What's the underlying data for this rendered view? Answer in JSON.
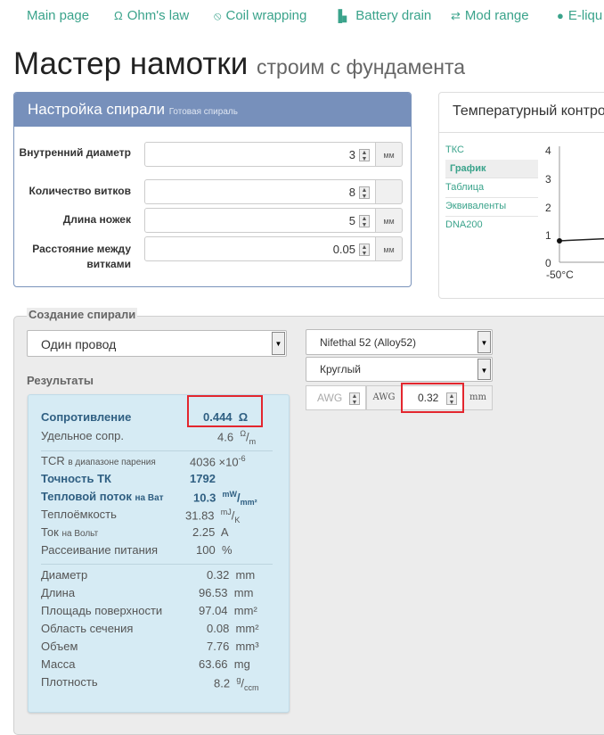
{
  "nav": [
    {
      "icon": "",
      "label": "Main page"
    },
    {
      "icon": "Ω",
      "label": "Ohm's law"
    },
    {
      "icon": "⦸",
      "label": "Coil wrapping"
    },
    {
      "icon": "▖",
      "label": "Battery drain"
    },
    {
      "icon": "⇄",
      "label": "Mod range"
    },
    {
      "icon": "💧",
      "label": "E-liqu"
    }
  ],
  "title": {
    "main": "Мастер намотки",
    "sub": "строим с фундамента"
  },
  "coil_settings": {
    "header": "Настройка спирали",
    "header_small": "Готовая спираль",
    "rows": [
      {
        "label": "Внутренний диаметр",
        "value": "3",
        "unit": "мм"
      },
      {
        "label": "Количество витков",
        "value": "8",
        "unit": ""
      },
      {
        "label": "Длина ножек",
        "value": "5",
        "unit": "мм"
      },
      {
        "label": "Расстояние между витками",
        "value": "0.05",
        "unit": "мм"
      }
    ]
  },
  "temp_panel": {
    "header": "Температурный контро",
    "menu": [
      "ТКС",
      "График",
      "Таблица",
      "Эквиваленты",
      "DNA200"
    ],
    "active": "График",
    "y_ticks": [
      "4",
      "3",
      "2",
      "1",
      "0"
    ],
    "x_tick": "-50°C"
  },
  "creation": {
    "legend": "Создание спирали",
    "wire_type": "Один провод",
    "material": "Nifethal 52 (Alloy52)",
    "profile": "Круглый",
    "awg_placeholder": "AWG",
    "awg_label": "AWG",
    "diameter_value": "0.32",
    "diameter_unit": "mm"
  },
  "results": {
    "title": "Результаты",
    "resistance": {
      "label": "Сопротивление",
      "value": "0.444",
      "unit": "Ω"
    },
    "specific": {
      "label": "Удельное сопр.",
      "value": "4.6",
      "unit_sup": "Ω",
      "unit_sub": "m"
    },
    "tcr": {
      "label": "TCR",
      "label_small": "в диапазоне парения",
      "value": "4036",
      "unit": "×10",
      "unit_sup": "-6"
    },
    "accuracy": {
      "label": "Точность ТК",
      "value": "1792"
    },
    "heat_flux": {
      "label": "Тепловой поток",
      "label_small": "на Ват",
      "value": "10.3",
      "unit_sup": "mW",
      "unit_sub": "mm²"
    },
    "heat_capacity": {
      "label": "Теплоёмкость",
      "value": "31.83",
      "unit_sup": "mJ",
      "unit_sub": "K"
    },
    "current": {
      "label": "Ток",
      "label_small": "на Вольт",
      "value": "2.25",
      "unit": "A"
    },
    "dissipation": {
      "label": "Рассеивание питания",
      "value": "100",
      "unit": "%"
    },
    "diameter": {
      "label": "Диаметр",
      "value": "0.32",
      "unit": "mm"
    },
    "length": {
      "label": "Длина",
      "value": "96.53",
      "unit": "mm"
    },
    "surface": {
      "label": "Площадь поверхности",
      "value": "97.04",
      "unit": "mm²"
    },
    "section": {
      "label": "Область сечения",
      "value": "0.08",
      "unit": "mm²"
    },
    "volume": {
      "label": "Объем",
      "value": "7.76",
      "unit": "mm³"
    },
    "mass": {
      "label": "Масса",
      "value": "63.66",
      "unit": "mg"
    },
    "density": {
      "label": "Плотность",
      "value": "8.2",
      "unit_sup": "g",
      "unit_sub": "ccm"
    }
  },
  "colors": {
    "accent": "#3aa38b",
    "panel_header": "#7790bb",
    "results_bg": "#d6ebf4",
    "highlight": "#e3262e"
  }
}
